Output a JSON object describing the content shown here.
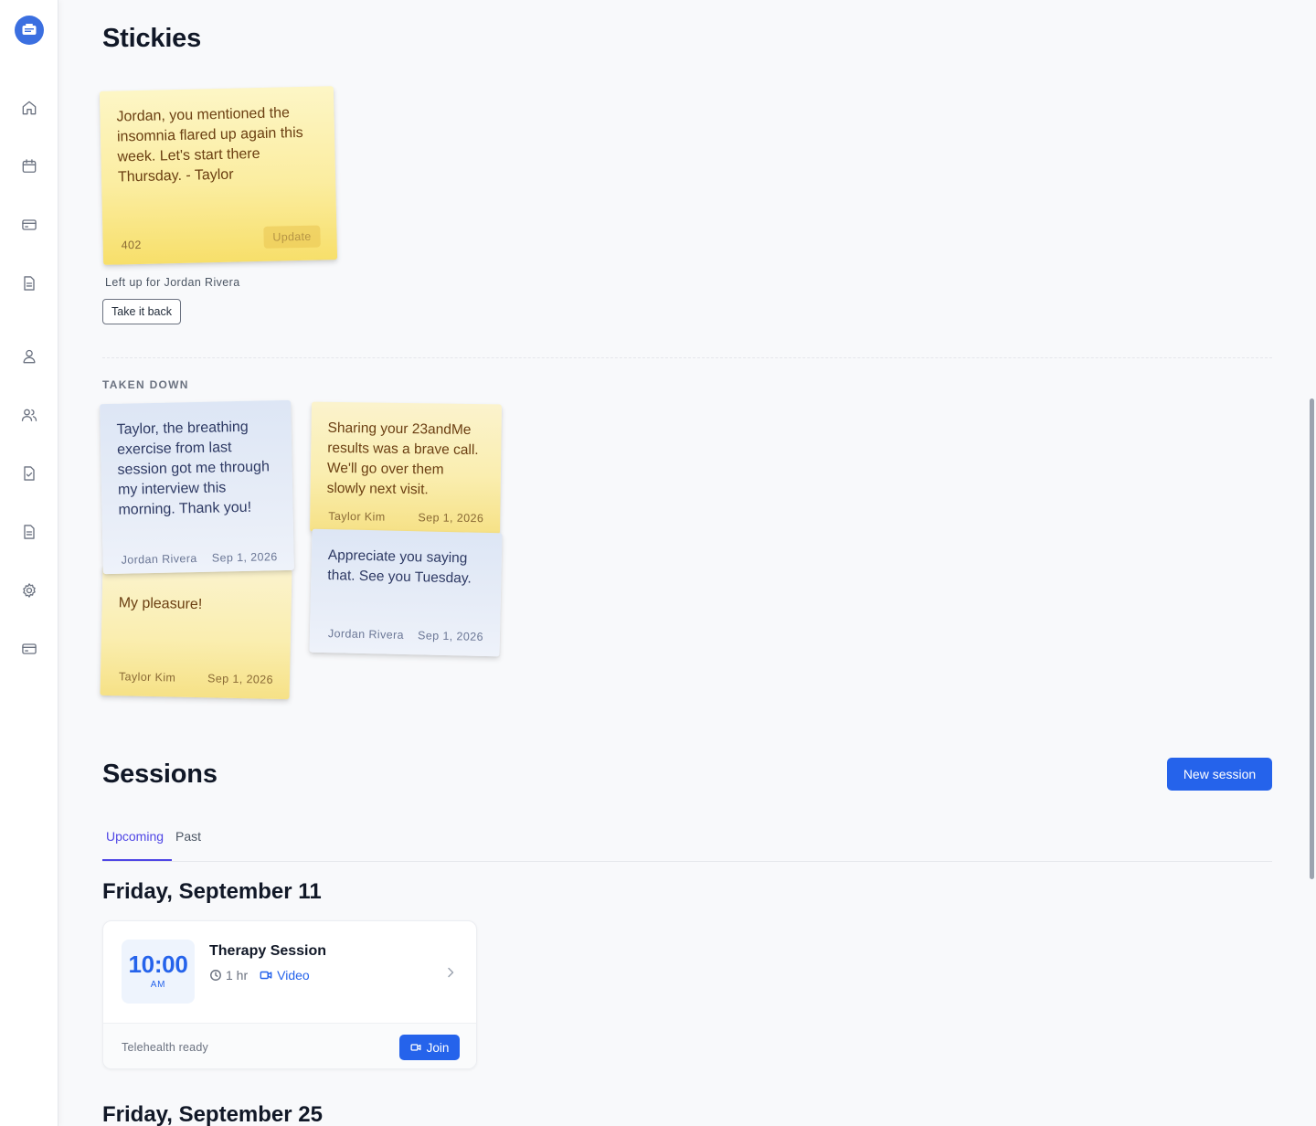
{
  "stickies": {
    "title": "Stickies",
    "active": {
      "text": "Jordan, you mentioned the insomnia flared up again this week. Let's start there Thursday. - Taylor",
      "char_count": "402",
      "update_label": "Update",
      "caption": "Left up for Jordan Rivera",
      "take_back_label": "Take it back"
    },
    "taken_down_label": "TAKEN DOWN",
    "taken_down": [
      {
        "text": "Taylor, the breathing exercise from last session got me through my interview this morning. Thank you!",
        "author": "Jordan Rivera",
        "date": "Sep 1, 2026",
        "color": "blue"
      },
      {
        "text": "My pleasure!",
        "author": "Taylor Kim",
        "date": "Sep 1, 2026",
        "color": "yellow"
      },
      {
        "text": "Sharing your 23andMe results was a brave call. We'll go over them slowly next visit.",
        "author": "Taylor Kim",
        "date": "Sep 1, 2026",
        "color": "yellow"
      },
      {
        "text": "Appreciate you saying that. See you Tuesday.",
        "author": "Jordan Rivera",
        "date": "Sep 1, 2026",
        "color": "blue"
      }
    ]
  },
  "sessions": {
    "title": "Sessions",
    "new_session_label": "New session",
    "tabs": [
      {
        "label": "Upcoming",
        "active": true
      },
      {
        "label": "Past",
        "active": false
      }
    ],
    "groups": [
      {
        "date": "Friday, September 11",
        "session": {
          "time": "10:00",
          "ampm": "AM",
          "title": "Therapy Session",
          "duration": "1 hr",
          "mode": "Video",
          "status": "Telehealth ready",
          "join_label": "Join"
        }
      },
      {
        "date": "Friday, September 25"
      }
    ]
  },
  "sidebar": {
    "icons": [
      "home-icon",
      "calendar-icon",
      "card-icon",
      "document-icon",
      "user-icon",
      "users-icon",
      "file-check-icon",
      "file-text-icon",
      "gear-icon",
      "billing-card-icon"
    ]
  },
  "colors": {
    "accent": "#2563eb",
    "tab_active": "#4f46e5",
    "sticky_yellow": "#f7df6a",
    "sticky_blue": "#dde6f5"
  }
}
